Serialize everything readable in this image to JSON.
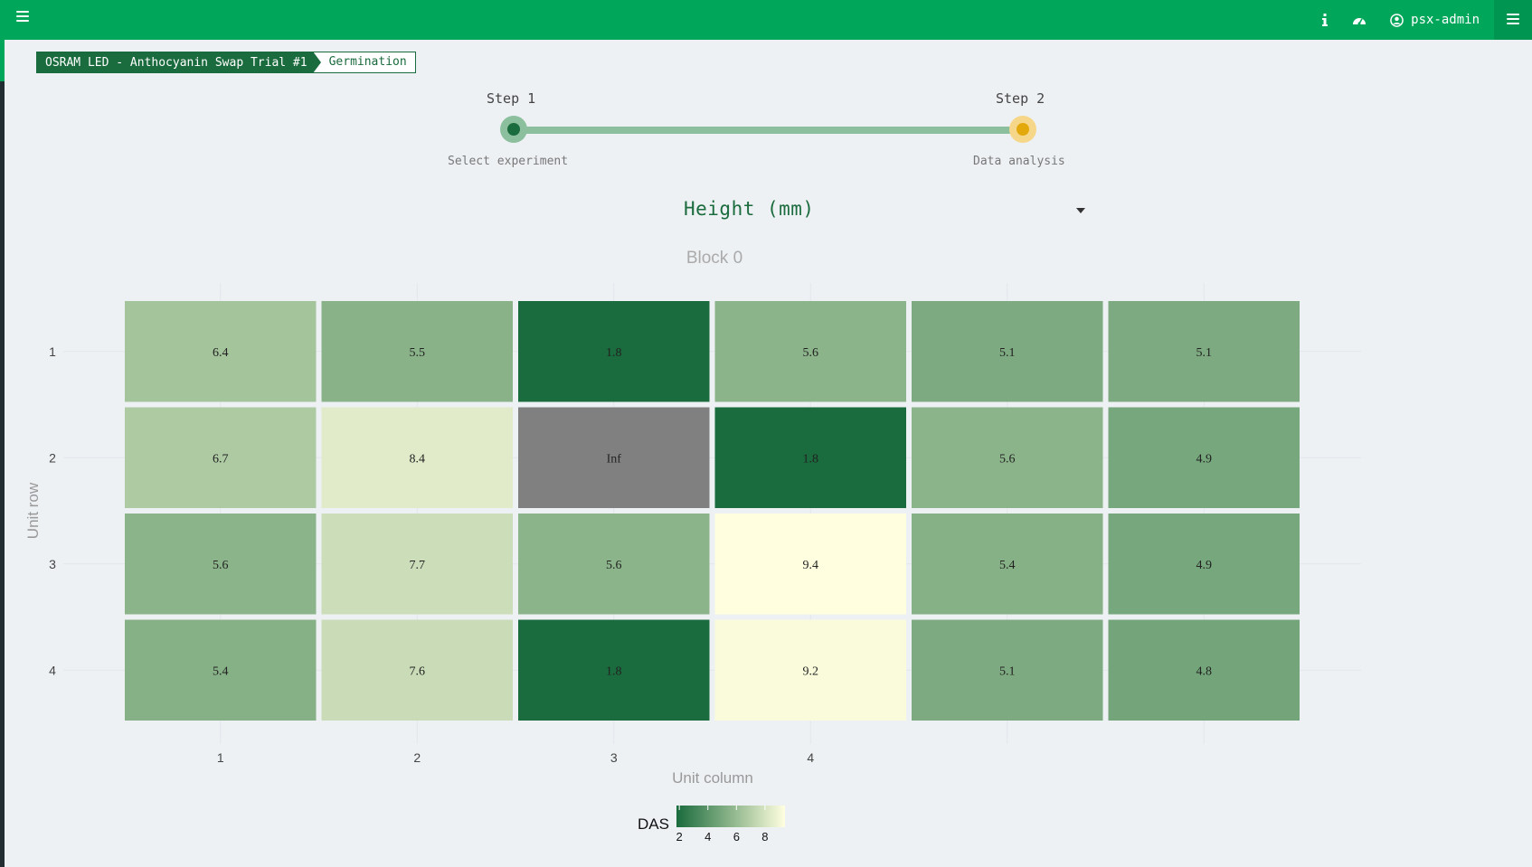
{
  "topbar": {
    "user": "psx-admin",
    "icons": [
      "menu-icon",
      "info-icon",
      "dashboard-icon",
      "user-circle-icon",
      "menu-icon"
    ],
    "color": "#00a65a"
  },
  "breadcrumb": {
    "experiment": "OSRAM LED - Anthocyanin Swap Trial #1",
    "phase": "Germination"
  },
  "stepper": {
    "steps": [
      {
        "title": "Step 1",
        "subtitle": "Select experiment",
        "state": "done"
      },
      {
        "title": "Step 2",
        "subtitle": "Data analysis",
        "state": "active"
      }
    ]
  },
  "metric_select": {
    "value": "Height (mm)"
  },
  "chart_data": {
    "type": "heatmap",
    "title": "Block 0",
    "xlabel": "Unit column",
    "ylabel": "Unit row",
    "x_tick_labels": [
      "1",
      "2",
      "3",
      "4"
    ],
    "y_tick_labels": [
      "1",
      "2",
      "3",
      "4"
    ],
    "rows": [
      [
        "6.4",
        "5.5",
        "1.8",
        "5.6",
        "5.1",
        "5.1"
      ],
      [
        "6.7",
        "8.4",
        "Inf",
        "1.8",
        "5.6",
        "4.9"
      ],
      [
        "5.6",
        "7.7",
        "5.6",
        "9.4",
        "5.4",
        "4.9"
      ],
      [
        "5.4",
        "7.6",
        "1.8",
        "9.2",
        "5.1",
        "4.8"
      ]
    ],
    "colorbar": {
      "title": "DAS",
      "ticks": [
        "2",
        "4",
        "6",
        "8"
      ],
      "range": [
        1.8,
        9.4
      ],
      "colors": [
        "#1a6b3d",
        "#8cb48a",
        "#ffffe0"
      ],
      "inf_color": "#808080"
    }
  }
}
